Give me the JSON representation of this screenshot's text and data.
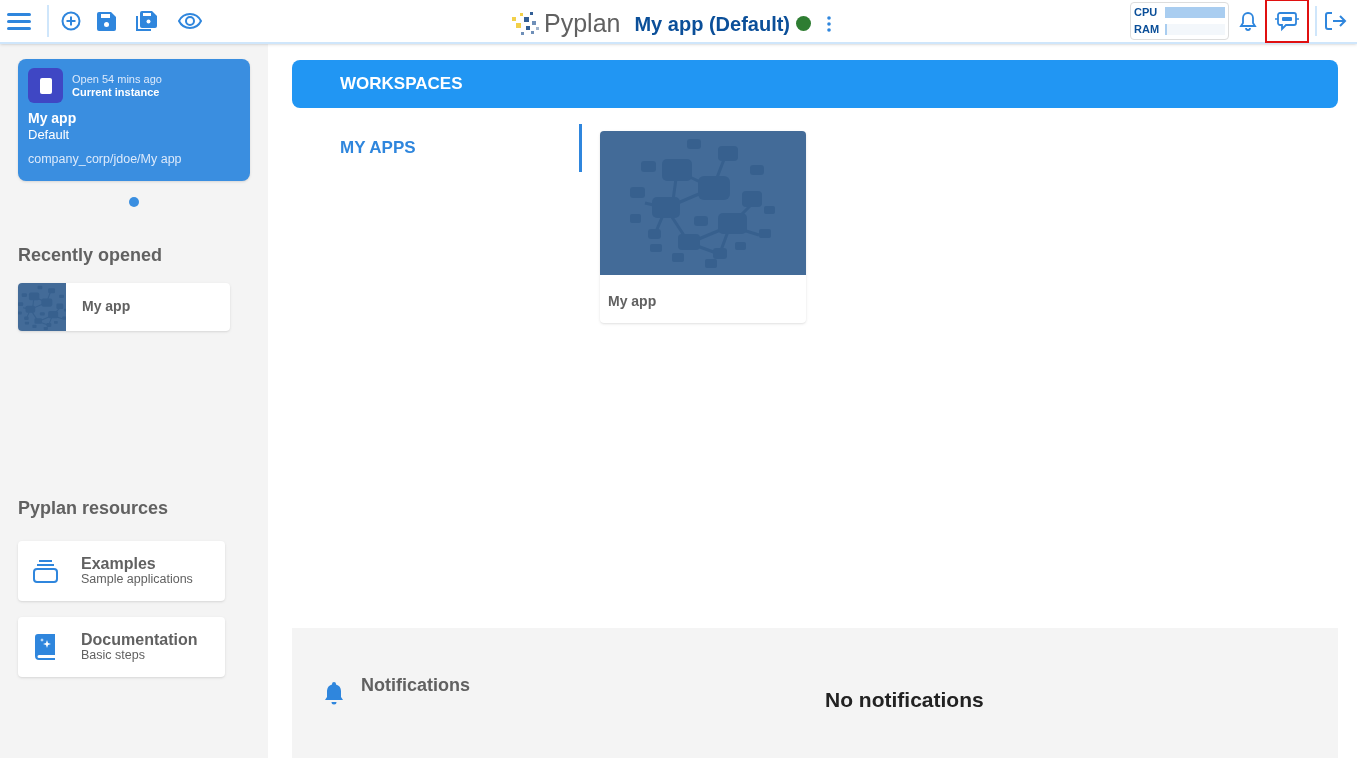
{
  "header": {
    "logo_text": "Pyplan",
    "app_title": "My app (Default)",
    "app_running": true,
    "meters": [
      {
        "label": "CPU",
        "level": 1.0
      },
      {
        "label": "RAM",
        "level": 0.02
      }
    ],
    "assistant_highlighted": true
  },
  "sidebar": {
    "current_instance": {
      "opened": "Open 54 mins ago",
      "status": "Current instance",
      "name": "My app",
      "version": "Default",
      "path": "company_corp/jdoe/My app"
    },
    "carousel_dots": [
      {
        "selected": true
      }
    ],
    "recent_title": "Recently opened",
    "recent": [
      {
        "name": "My app"
      }
    ],
    "resources_title": "Pyplan resources",
    "resources": [
      {
        "kind": "examples",
        "title": "Examples",
        "subtitle": "Sample applications"
      },
      {
        "kind": "documentation",
        "title": "Documentation",
        "subtitle": "Basic steps"
      }
    ]
  },
  "main": {
    "workspaces_label": "WORKSPACES",
    "tabs": [
      {
        "label": "MY APPS",
        "selected": true
      }
    ],
    "apps": [
      {
        "name": "My app"
      }
    ],
    "notifications": {
      "title": "Notifications",
      "message": "No notifications"
    }
  }
}
